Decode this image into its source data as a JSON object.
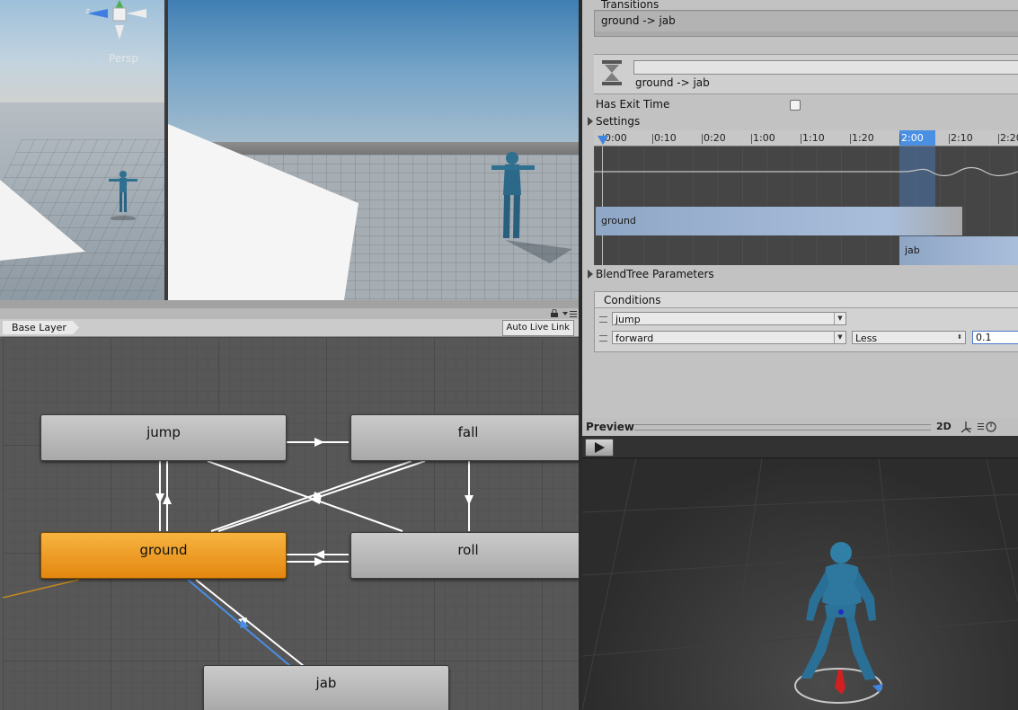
{
  "scene": {
    "persp_label": "Persp",
    "axis_z_label": "z"
  },
  "animator": {
    "layer": "Base Layer",
    "auto_live_link": "Auto Live Link",
    "states": {
      "jump": "jump",
      "fall": "fall",
      "ground": "ground",
      "roll": "roll",
      "jab": "jab"
    }
  },
  "inspector": {
    "transitions_header": "Transitions",
    "selected_transition": "ground -> jab",
    "transition_name": "ground -> jab",
    "has_exit_time_label": "Has Exit Time",
    "has_exit_time": false,
    "settings_label": "Settings",
    "timeline_ticks": [
      "0:00",
      "0:10",
      "0:20",
      "1:00",
      "1:10",
      "1:20",
      "2:00",
      "2:10",
      "2:20"
    ],
    "clip_source": "ground",
    "clip_dest": "jab",
    "blendtree_label": "BlendTree Parameters",
    "conditions_label": "Conditions",
    "conditions": [
      {
        "parameter": "jump"
      },
      {
        "parameter": "forward",
        "mode": "Less",
        "value": "0.1"
      }
    ]
  },
  "preview": {
    "title": "Preview",
    "mode": "2D"
  },
  "colors": {
    "active_state": "#f0a02a",
    "selected_transition": "#4a8ee6",
    "model_blue": "#2f7fa6"
  }
}
